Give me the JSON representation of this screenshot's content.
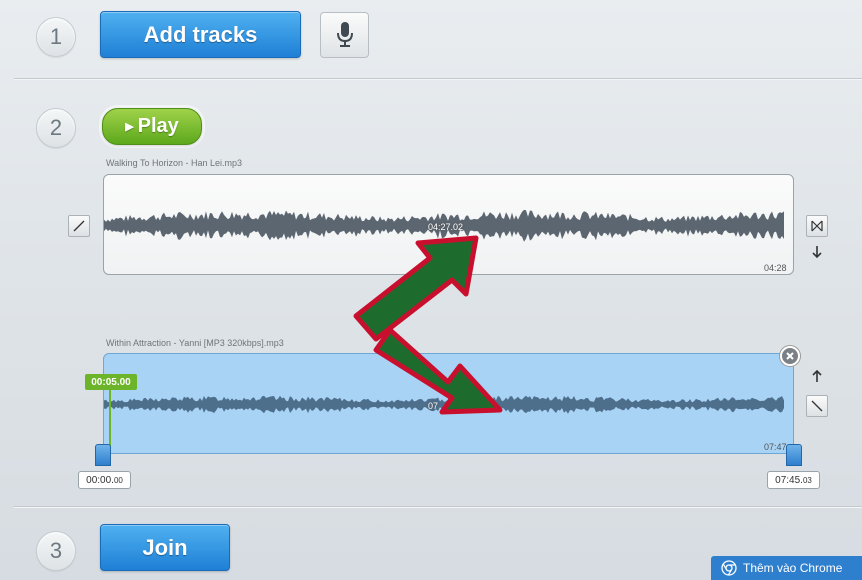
{
  "steps": {
    "step1": "1",
    "step2": "2",
    "step3": "3"
  },
  "buttons": {
    "add_tracks": "Add tracks",
    "play": "Play",
    "join": "Join"
  },
  "tracks": [
    {
      "name": "Walking To Horizon - Han Lei.mp3",
      "cursor_time": "04:27.02",
      "duration": "04:28"
    },
    {
      "name": "Within Attraction - Yanni [MP3 320kbps].mp3",
      "cursor_time": "07",
      "duration": "07:47",
      "start_marker": "00:05.00",
      "range_start_main": "00:00.",
      "range_start_ms": "00",
      "range_end_main": "07:45.",
      "range_end_ms": "03"
    }
  ],
  "chrome": {
    "label": "Thêm vào Chrome"
  },
  "icons": [
    "microphone-icon",
    "play-triangle-icon",
    "fade-in-icon",
    "fade-out-icon",
    "crossfade-icon",
    "arrow-down-icon",
    "arrow-up-icon",
    "close-icon",
    "chrome-icon"
  ],
  "colors": {
    "blue_button": "#1f7fd6",
    "green_button": "#5da81c",
    "selection": "#a9d3f5",
    "arrow_fill": "#1e6b2e",
    "arrow_outline": "#c8102e"
  }
}
